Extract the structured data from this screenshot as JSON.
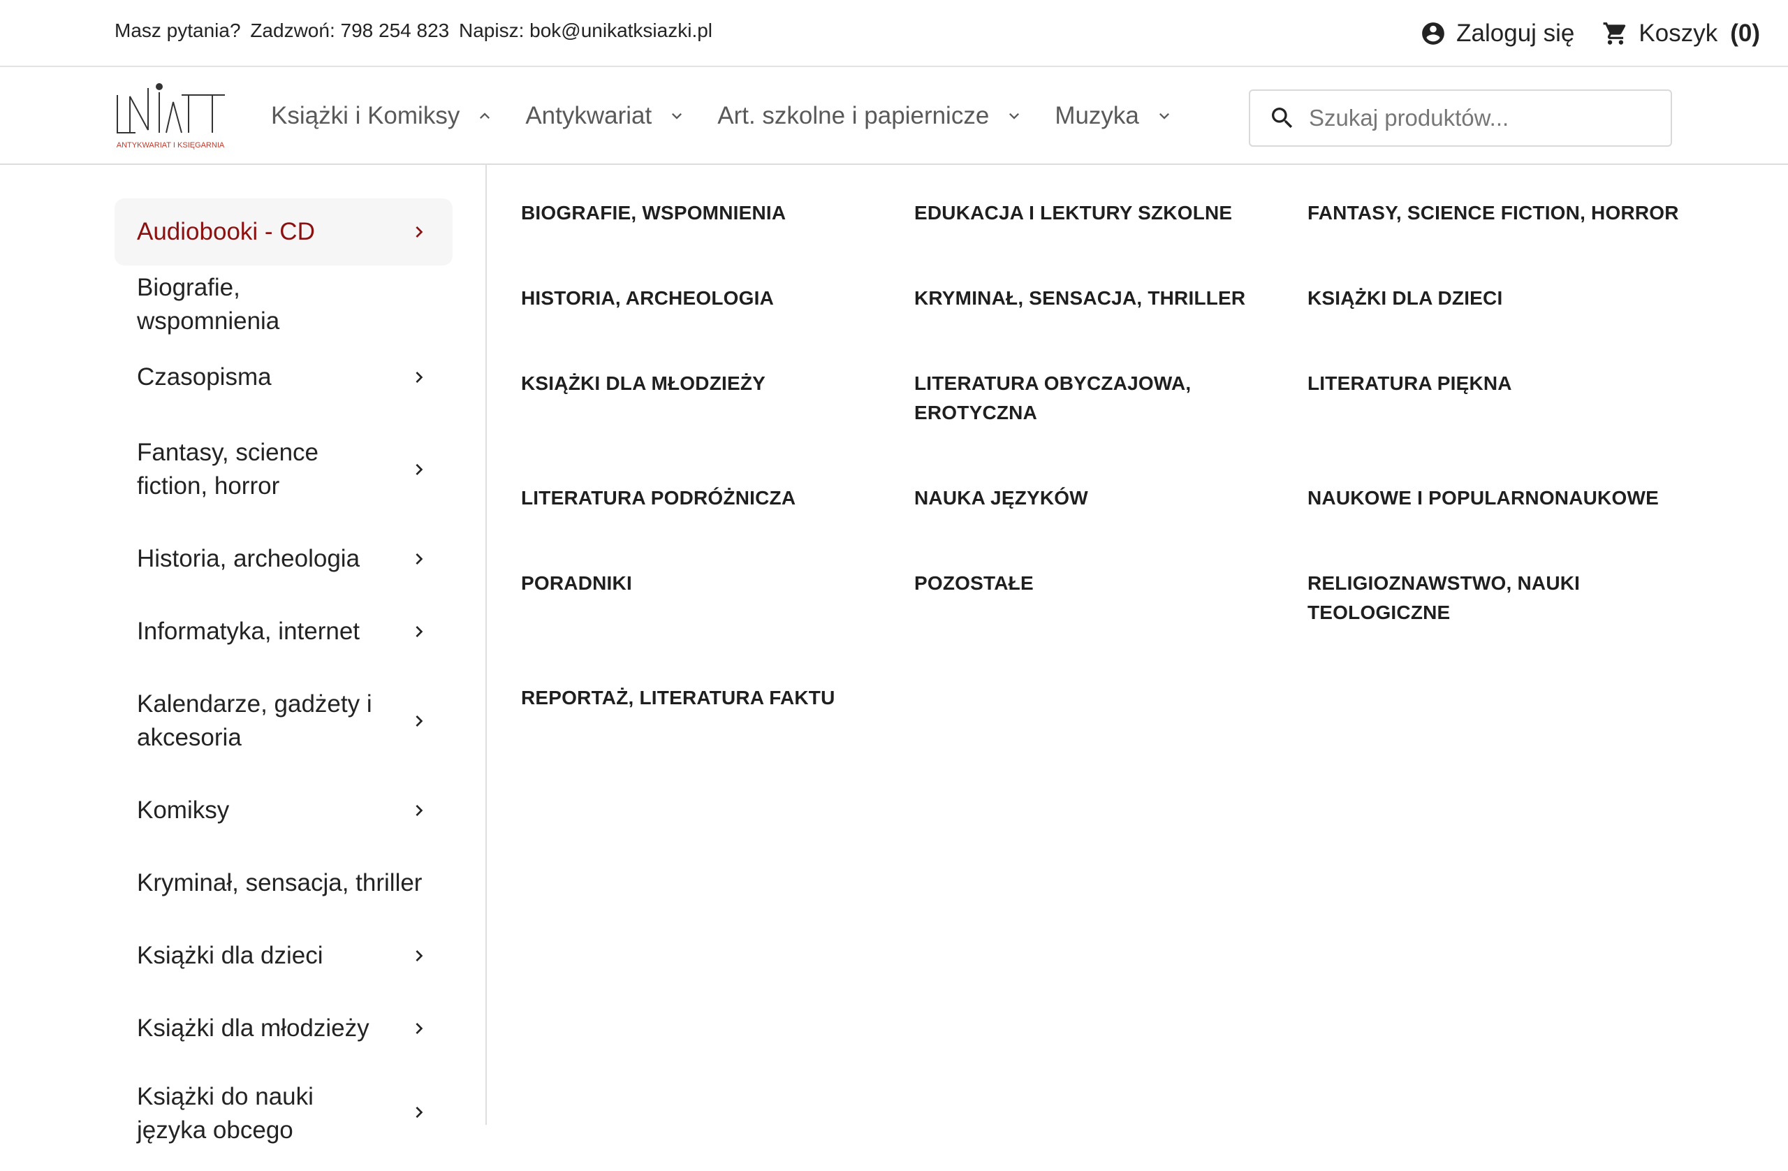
{
  "topbar": {
    "contact_question": "Masz pytania?",
    "contact_phone": "Zadzwoń: 798 254 823",
    "contact_email": "Napisz: bok@unikatksiazki.pl",
    "login_label": "Zaloguj się",
    "cart_label": "Koszyk",
    "cart_count": "(0)"
  },
  "header": {
    "logo": {
      "text": "UNIKAT",
      "tagline": "ANTYKWARIAT I KSIĘGARNIA",
      "accent": "#c0392b"
    },
    "nav": [
      {
        "label": "Książki i Komiksy",
        "icon": "chevron-up-icon"
      },
      {
        "label": "Antykwariat",
        "icon": "chevron-down-icon"
      },
      {
        "label": "Art. szkolne i papiernicze",
        "icon": "chevron-down-icon"
      },
      {
        "label": "Muzyka",
        "icon": "chevron-down-icon"
      }
    ],
    "search": {
      "placeholder": "Szukaj produktów...",
      "value": ""
    }
  },
  "menu": {
    "sidebar": [
      {
        "label": "Audiobooki - CD",
        "has_children": true,
        "active": true
      },
      {
        "label": "Biografie, wspomnienia",
        "has_children": false
      },
      {
        "label": "Czasopisma",
        "has_children": true
      },
      {
        "label": "Fantasy, science fiction, horror",
        "has_children": true
      },
      {
        "label": "Historia, archeologia",
        "has_children": true
      },
      {
        "label": "Informatyka, internet",
        "has_children": true
      },
      {
        "label": "Kalendarze, gadżety i akcesoria",
        "has_children": true
      },
      {
        "label": "Komiksy",
        "has_children": true
      },
      {
        "label": "Kryminał, sensacja, thriller",
        "has_children": false
      },
      {
        "label": "Książki dla dzieci",
        "has_children": true
      },
      {
        "label": "Książki dla młodzieży",
        "has_children": true
      },
      {
        "label": "Książki do nauki języka obcego",
        "has_children": true
      }
    ],
    "subcategories": [
      "BIOGRAFIE, WSPOMNIENIA",
      "EDUKACJA I LEKTURY SZKOLNE",
      "FANTASY, SCIENCE FICTION, HORROR",
      "HISTORIA, ARCHEOLOGIA",
      "KRYMINAŁ, SENSACJA, THRILLER",
      "KSIĄŻKI DLA DZIECI",
      "KSIĄŻKI DLA MŁODZIEŻY",
      "LITERATURA OBYCZAJOWA, EROTYCZNA",
      "LITERATURA PIĘKNA",
      "LITERATURA PODRÓŻNICZA",
      "NAUKA JĘZYKÓW",
      "NAUKOWE I POPULARNONAUKOWE",
      "PORADNIKI",
      "POZOSTAŁE",
      "RELIGIOZNAWSTWO, NAUKI TEOLOGICZNE",
      "REPORTAŻ, LITERATURA FAKTU"
    ]
  },
  "colors": {
    "active_text": "#8b1010",
    "active_bg": "#f6f6f7",
    "text": "#232323",
    "nav_text": "#595959"
  }
}
